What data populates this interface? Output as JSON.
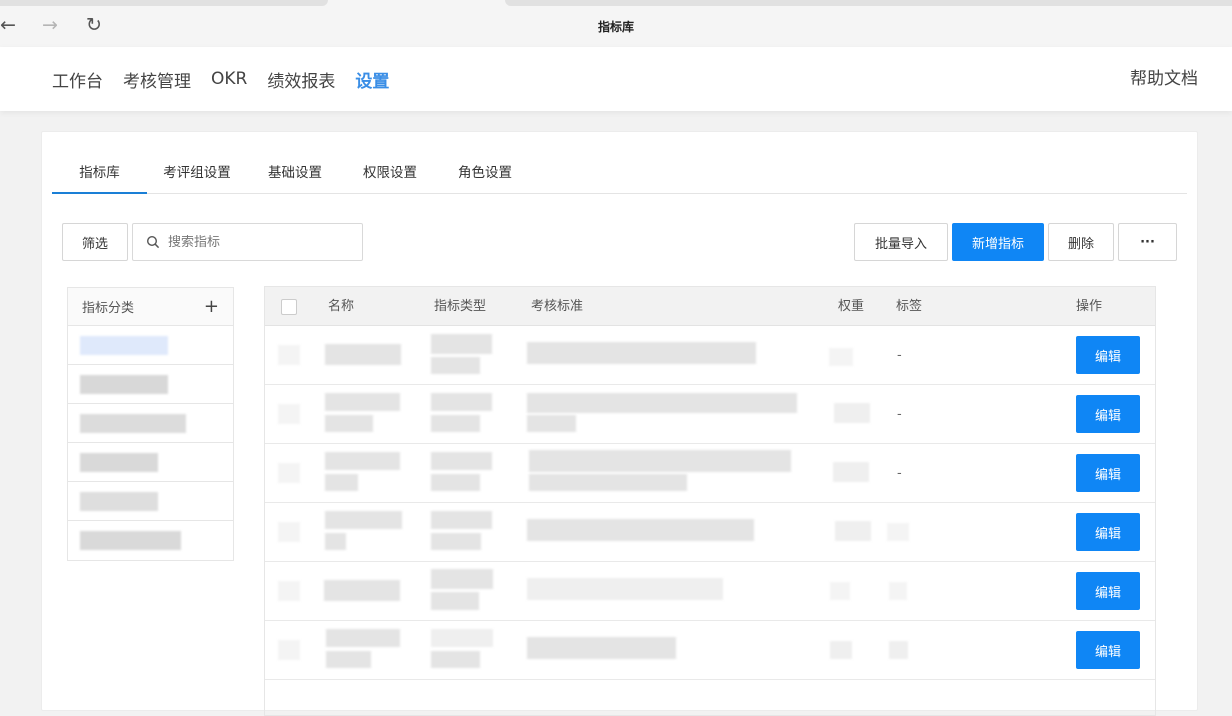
{
  "browser": {
    "tab_title": "指标库",
    "back_icon": "←",
    "forward_icon": "→",
    "reload_icon": "↻"
  },
  "topnav": {
    "items": [
      {
        "label": "工作台",
        "active": false
      },
      {
        "label": "考核管理",
        "active": false
      },
      {
        "label": "OKR",
        "active": false
      },
      {
        "label": "绩效报表",
        "active": false
      },
      {
        "label": "设置",
        "active": true
      }
    ],
    "help": "帮助文档",
    "accent": "#3a8ee6"
  },
  "subtabs": [
    {
      "label": "指标库",
      "active": true
    },
    {
      "label": "考评组设置",
      "active": false
    },
    {
      "label": "基础设置",
      "active": false
    },
    {
      "label": "权限设置",
      "active": false
    },
    {
      "label": "角色设置",
      "active": false
    }
  ],
  "toolbar": {
    "filter": "筛选",
    "search_placeholder": "搜索指标",
    "import": "批量导入",
    "add": "新增指标",
    "delete": "删除",
    "more": "···",
    "primary_color": "#0f86f5"
  },
  "categories": {
    "title": "指标分类",
    "add_icon": "+"
  },
  "table": {
    "columns": [
      "名称",
      "指标类型",
      "考核标准",
      "权重",
      "标签",
      "操作"
    ],
    "rows": [
      {
        "tag": "-",
        "action": "编辑"
      },
      {
        "tag": "-",
        "action": "编辑"
      },
      {
        "tag": "-",
        "action": "编辑"
      },
      {
        "tag": "",
        "action": "编辑"
      },
      {
        "tag": "",
        "action": "编辑"
      },
      {
        "tag": "",
        "action": "编辑"
      }
    ]
  }
}
